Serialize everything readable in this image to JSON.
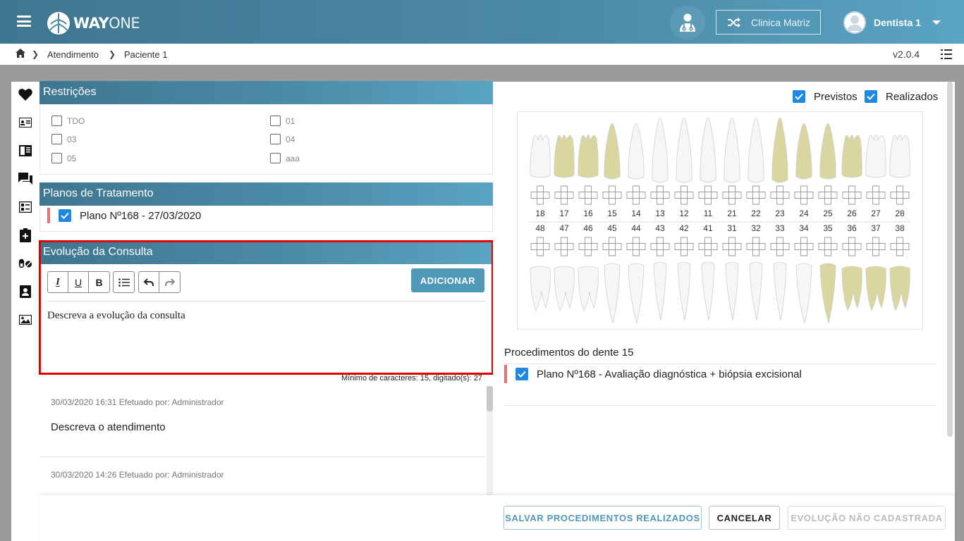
{
  "header": {
    "logo_bold": "WAY",
    "logo_light": "ONE",
    "clinic_label": "Clinica Matriz",
    "user_name": "Dentista 1"
  },
  "breadcrumb": {
    "items": [
      "Atendimento",
      "Paciente 1"
    ],
    "version": "v2.0.4"
  },
  "restricoes": {
    "title": "Restrições",
    "options": [
      "TDO",
      "01",
      "03",
      "04",
      "05",
      "aaa"
    ]
  },
  "planos": {
    "title": "Planos de Tratamento",
    "items": [
      "Plano Nº168 - 27/03/2020"
    ]
  },
  "evolucao": {
    "title": "Evolução da Consulta",
    "toolbar": {
      "italic": "I",
      "underline": "U",
      "bold": "B"
    },
    "add_button": "ADICIONAR",
    "placeholder": "Descreva a evolução da consulta",
    "min_chars": "Mínimo de caracteres: 15, digitado(s): 27"
  },
  "history": [
    {
      "meta": "30/03/2020 16:31 Efetuado por: Administrador",
      "text": "Descreva o atendimento"
    },
    {
      "meta": "30/03/2020 14:26 Efetuado por: Administrador",
      "text": ""
    }
  ],
  "odontogram": {
    "legend": {
      "previstos": "Previstos",
      "realizados": "Realizados"
    },
    "upper_teeth": [
      "18",
      "17",
      "16",
      "15",
      "14",
      "13",
      "12",
      "11",
      "21",
      "22",
      "23",
      "24",
      "25",
      "26",
      "27",
      "28"
    ],
    "lower_teeth": [
      "48",
      "47",
      "46",
      "45",
      "44",
      "43",
      "42",
      "41",
      "31",
      "32",
      "33",
      "34",
      "35",
      "36",
      "37",
      "38"
    ],
    "highlighted_upper": [
      "17",
      "16",
      "15",
      "23",
      "24",
      "25",
      "26"
    ],
    "highlighted_lower": [
      "35",
      "36",
      "37",
      "38"
    ],
    "highlight_color": "#d9d6a0"
  },
  "procedures": {
    "title": "Procedimentos do dente 15",
    "items": [
      "Plano Nº168 - Avaliação diagnóstica + biópsia excisional"
    ]
  },
  "footer": {
    "save": "SALVAR PROCEDIMENTOS REALIZADOS",
    "cancel": "CANCELAR",
    "status": "EVOLUÇÃO NÃO CADASTRADA"
  },
  "colors": {
    "header": "#4b8ba8",
    "accent": "#4f98b7",
    "checkbox": "#1e88e5",
    "highlight_border": "#e00000",
    "plan_marker": "#e57373"
  }
}
